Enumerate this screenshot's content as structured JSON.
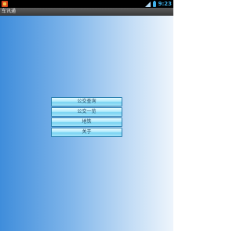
{
  "status_bar": {
    "time": "9:23",
    "notification_icon": "app-notification-icon",
    "signal_icon": "signal-icon",
    "battery_icon": "battery-icon",
    "accent_color": "#3fb0e9"
  },
  "app": {
    "title": "车讯通"
  },
  "menu": {
    "items": [
      {
        "label": "公交查询"
      },
      {
        "label": "公交一览"
      },
      {
        "label": "地铁"
      },
      {
        "label": "关于"
      }
    ]
  },
  "colors": {
    "gradient_left": "#3f8ddb",
    "gradient_right": "#eef5fc",
    "button_fill": "#aee9fb",
    "button_border": "#2a7fb0"
  }
}
